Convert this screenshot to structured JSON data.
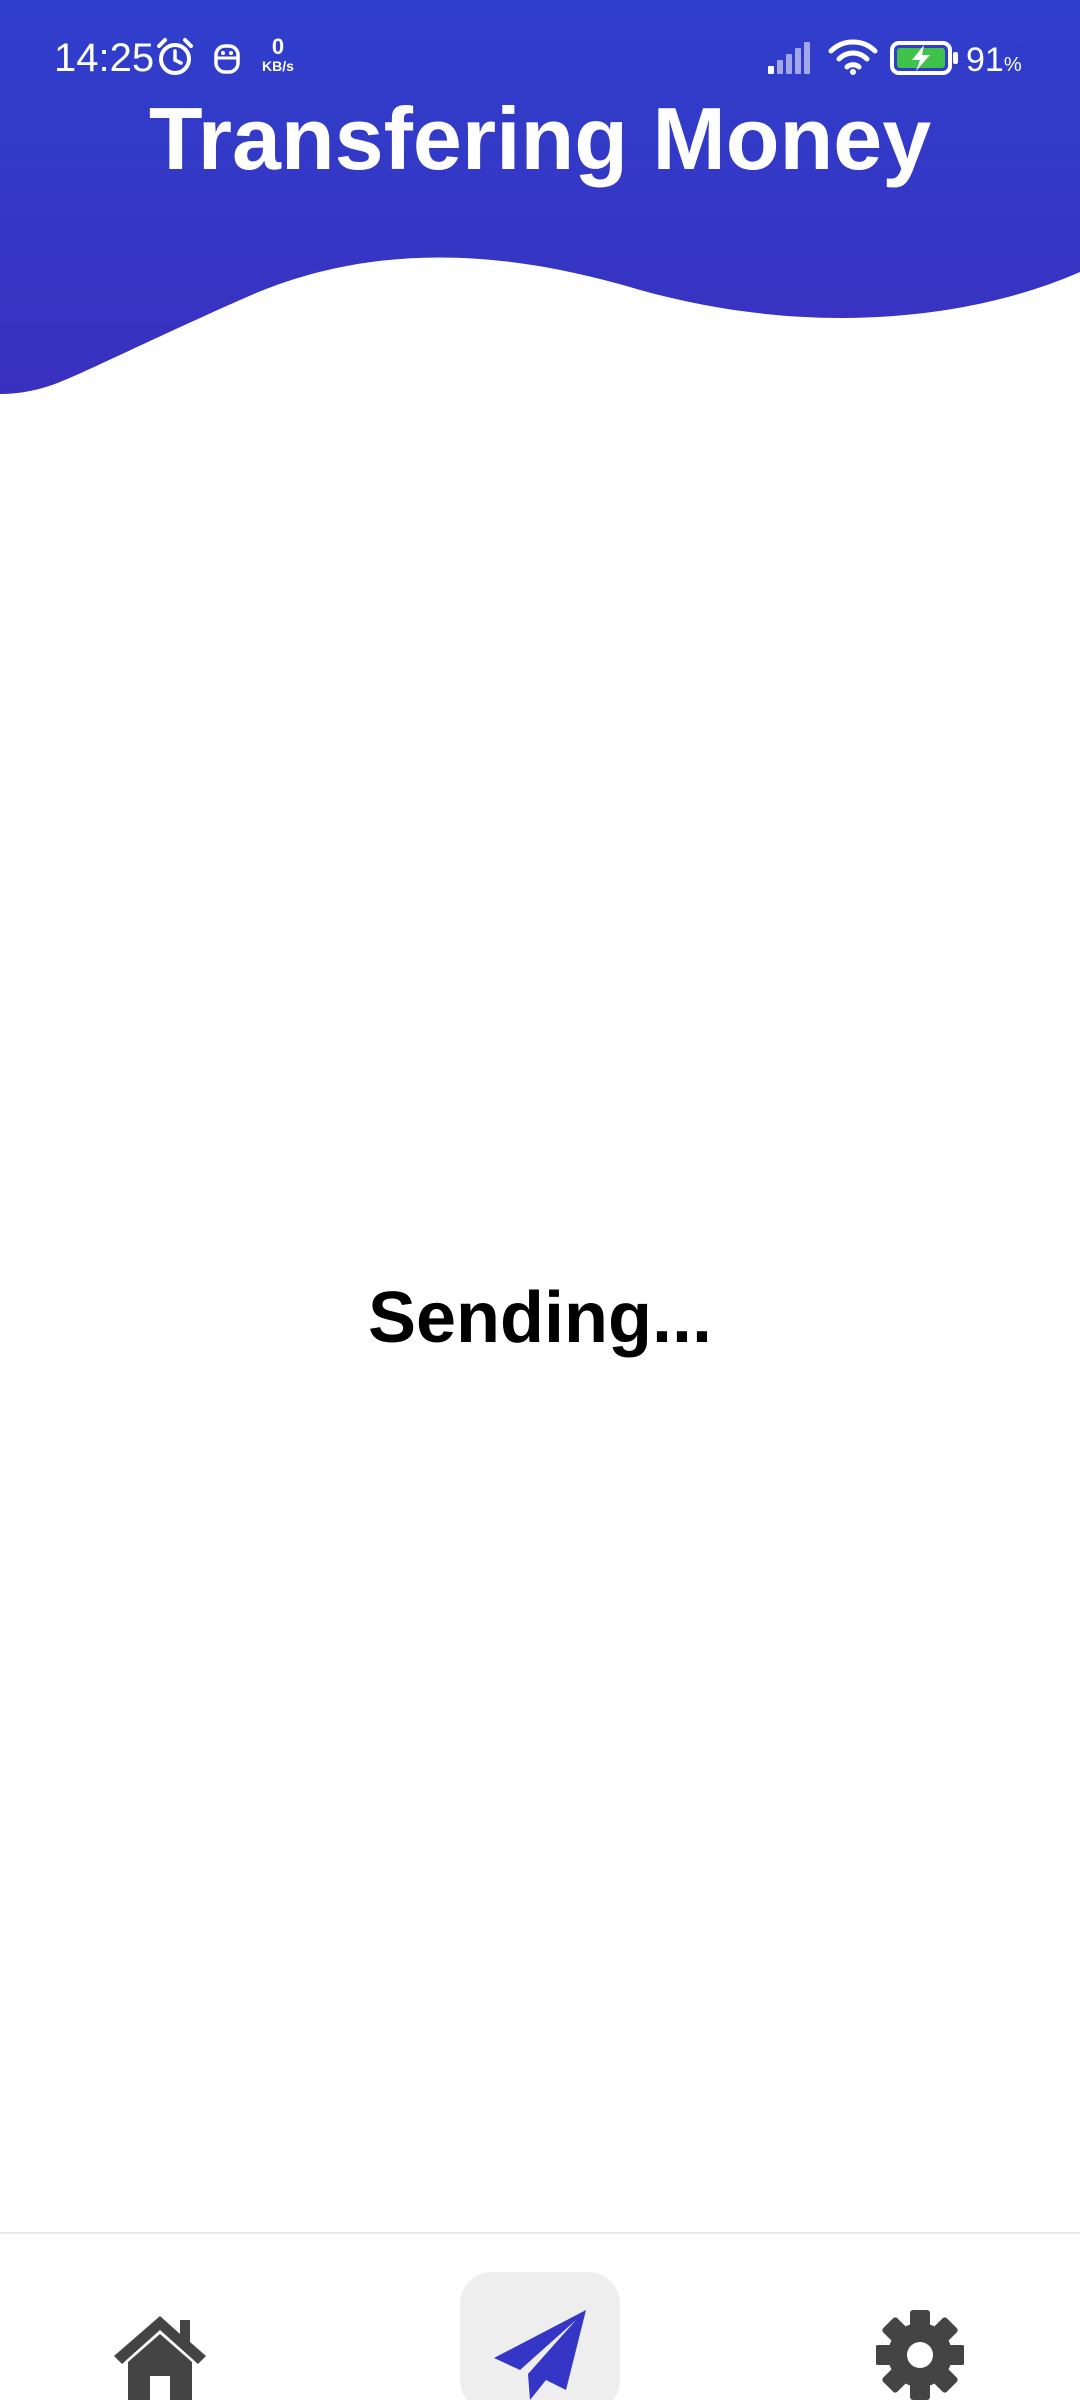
{
  "status_bar": {
    "time": "14:25",
    "net_speed_value": "0",
    "net_speed_unit": "KB/s",
    "battery_percent": "91",
    "battery_unit": "%",
    "icons": [
      "alarm-icon",
      "robot-icon",
      "signal-icon",
      "wifi-icon",
      "battery-charging-icon"
    ]
  },
  "header": {
    "title": "Transfering Money",
    "color": "#3535c6"
  },
  "main": {
    "status_text": "Sending..."
  },
  "bottom_nav": {
    "items": [
      {
        "name": "home",
        "icon": "home-icon",
        "active": false
      },
      {
        "name": "send",
        "icon": "paper-plane-icon",
        "active": true
      },
      {
        "name": "settings",
        "icon": "gear-icon",
        "active": false
      }
    ],
    "active_color": "#3535c6",
    "inactive_color": "#444444"
  }
}
